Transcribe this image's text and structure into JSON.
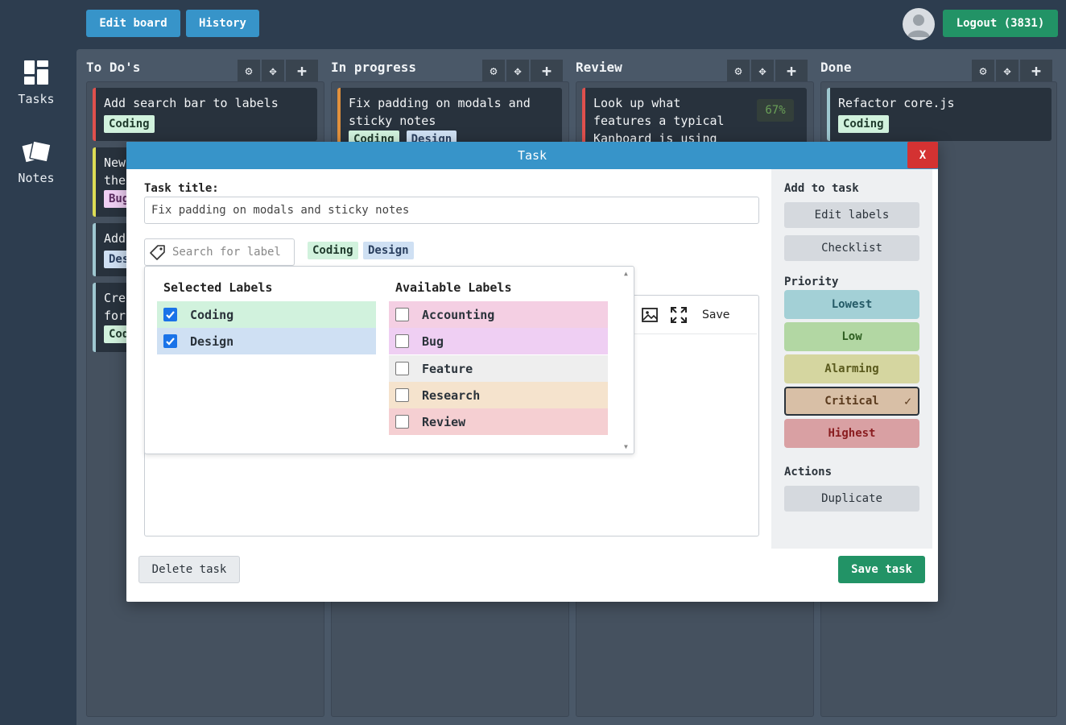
{
  "topbar": {
    "edit_board": "Edit board",
    "history": "History",
    "logout": "Logout (3831)"
  },
  "sidebar": {
    "tasks": "Tasks",
    "notes": "Notes"
  },
  "columns": [
    {
      "title": "To Do's"
    },
    {
      "title": "In progress"
    },
    {
      "title": "Review"
    },
    {
      "title": "Done"
    }
  ],
  "cards": {
    "todo": [
      {
        "title": "Add search bar to labels",
        "label": "Coding"
      },
      {
        "title": "New",
        "title2": "the",
        "label": "Bug"
      },
      {
        "title": "Add",
        "label": "Des"
      },
      {
        "title": "Crea",
        "title2": "for",
        "label": "Cod"
      }
    ],
    "inprogress": [
      {
        "title": "Fix padding on modals and sticky notes",
        "label1": "Coding",
        "label2": "Design"
      }
    ],
    "review": [
      {
        "title": "Look up what features a typical Kanboard is using",
        "progress": "67%"
      }
    ],
    "done": [
      {
        "title": "Refactor core.js",
        "label": "Coding"
      }
    ]
  },
  "modal": {
    "header": "Task",
    "close": "X",
    "task_title_label": "Task title:",
    "task_title_value": "Fix padding on modals and sticky notes",
    "label_search_placeholder": "Search for label",
    "chips": [
      "Coding",
      "Design"
    ],
    "editor_save": "Save",
    "delete": "Delete task",
    "save": "Save task"
  },
  "labels_dropdown": {
    "selected_title": "Selected Labels",
    "available_title": "Available Labels",
    "selected": [
      {
        "name": "Coding",
        "color": "#d1f2dd",
        "checked": true
      },
      {
        "name": "Design",
        "color": "#cfe0f3",
        "checked": true
      }
    ],
    "available": [
      {
        "name": "Accounting",
        "color": "#f4cfe3",
        "checked": false
      },
      {
        "name": "Bug",
        "color": "#efcff3",
        "checked": false
      },
      {
        "name": "Feature",
        "color": "#eeeeee",
        "checked": false
      },
      {
        "name": "Research",
        "color": "#f5e3cd",
        "checked": false
      },
      {
        "name": "Review",
        "color": "#f5cfd2",
        "checked": false
      }
    ]
  },
  "right_panel": {
    "add_title": "Add to task",
    "edit_labels": "Edit labels",
    "checklist": "Checklist",
    "priority_title": "Priority",
    "priorities": [
      {
        "name": "Lowest",
        "bg": "#a3d0d6",
        "fg": "#245a66",
        "selected": false
      },
      {
        "name": "Low",
        "bg": "#b2d7a3",
        "fg": "#2d5e20",
        "selected": false
      },
      {
        "name": "Alarming",
        "bg": "#d5d6a0",
        "fg": "#5a5a1d",
        "selected": false
      },
      {
        "name": "Critical",
        "bg": "#d8bfa6",
        "fg": "#5a3a1d",
        "selected": true
      },
      {
        "name": "Highest",
        "bg": "#d9a0a3",
        "fg": "#8a1d20",
        "selected": false
      }
    ],
    "selected_mark": "✓",
    "actions_title": "Actions",
    "duplicate": "Duplicate"
  }
}
